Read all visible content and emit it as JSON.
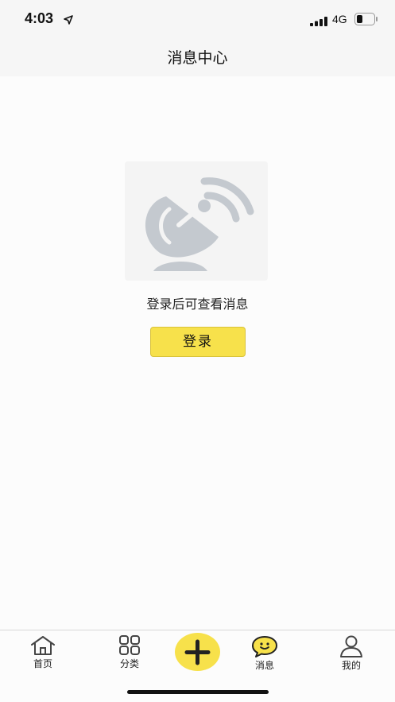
{
  "status_bar": {
    "time": "4:03",
    "network": "4G"
  },
  "nav": {
    "title": "消息中心"
  },
  "empty_state": {
    "message": "登录后可查看消息",
    "login_label": "登录"
  },
  "tabs": [
    {
      "label": "首页",
      "icon": "home-icon"
    },
    {
      "label": "分类",
      "icon": "grid-icon"
    },
    {
      "label": "",
      "icon": "plus-icon"
    },
    {
      "label": "消息",
      "icon": "smiley-chat-icon"
    },
    {
      "label": "我的",
      "icon": "user-icon"
    }
  ],
  "colors": {
    "accent": "#f7e14b",
    "illustration_gray": "#c4c9cf",
    "background": "#fcfcfc"
  }
}
